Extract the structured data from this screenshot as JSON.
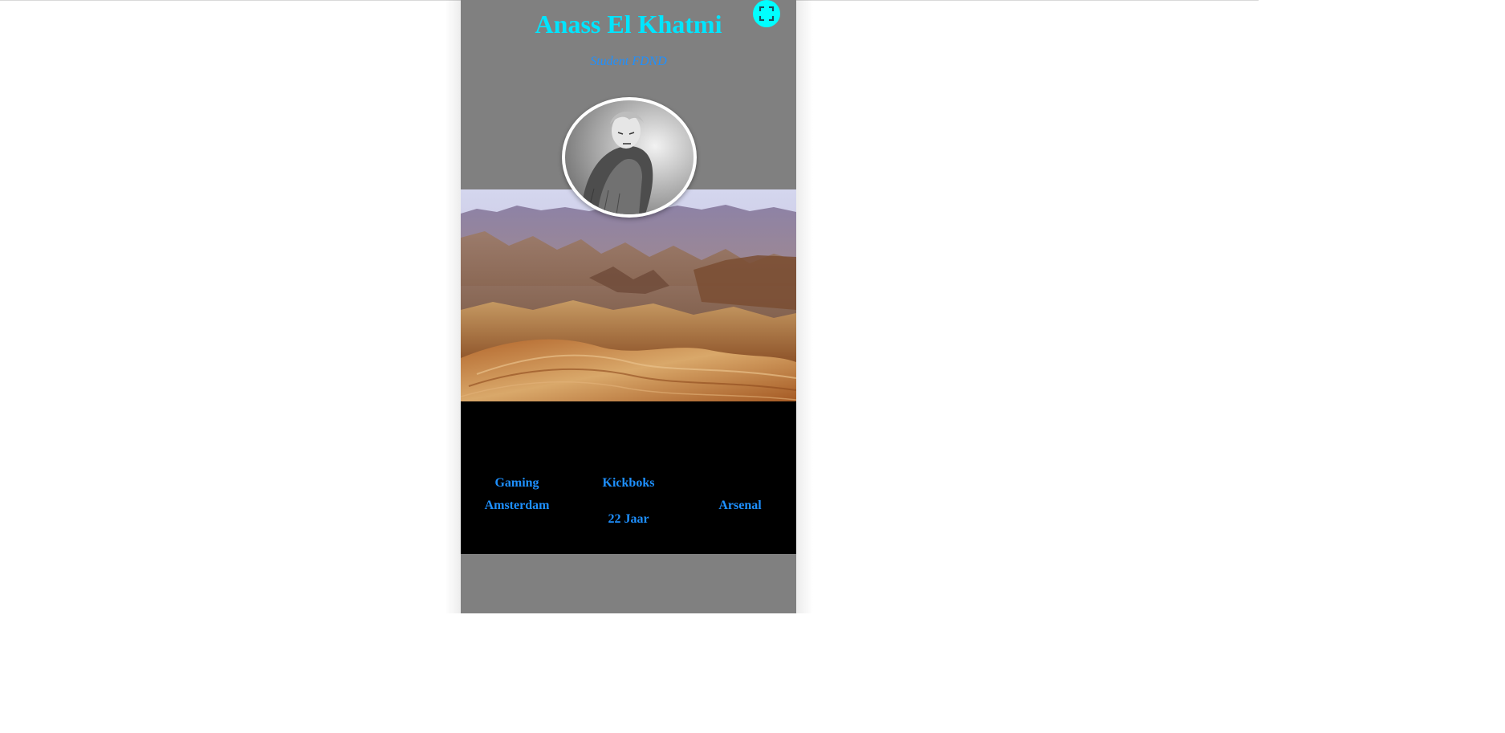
{
  "profile": {
    "name": "Anass El Khatmi",
    "role": "Student FDND"
  },
  "controls": {
    "fullscreen_icon": "fullscreen-icon"
  },
  "images": {
    "avatar": "manga-character-portrait",
    "banner": "desert-mountain-landscape"
  },
  "interests": {
    "gaming": "Gaming",
    "kickboks": "Kickboks",
    "city": "Amsterdam",
    "club": "Arsenal",
    "age": "22 Jaar"
  },
  "colors": {
    "page_background": "#ffffff",
    "card_background": "#808080",
    "title": "#00e5ff",
    "accent_text": "#1e90ff",
    "fullscreen_button": "#00ffff",
    "info_background": "#000000"
  }
}
